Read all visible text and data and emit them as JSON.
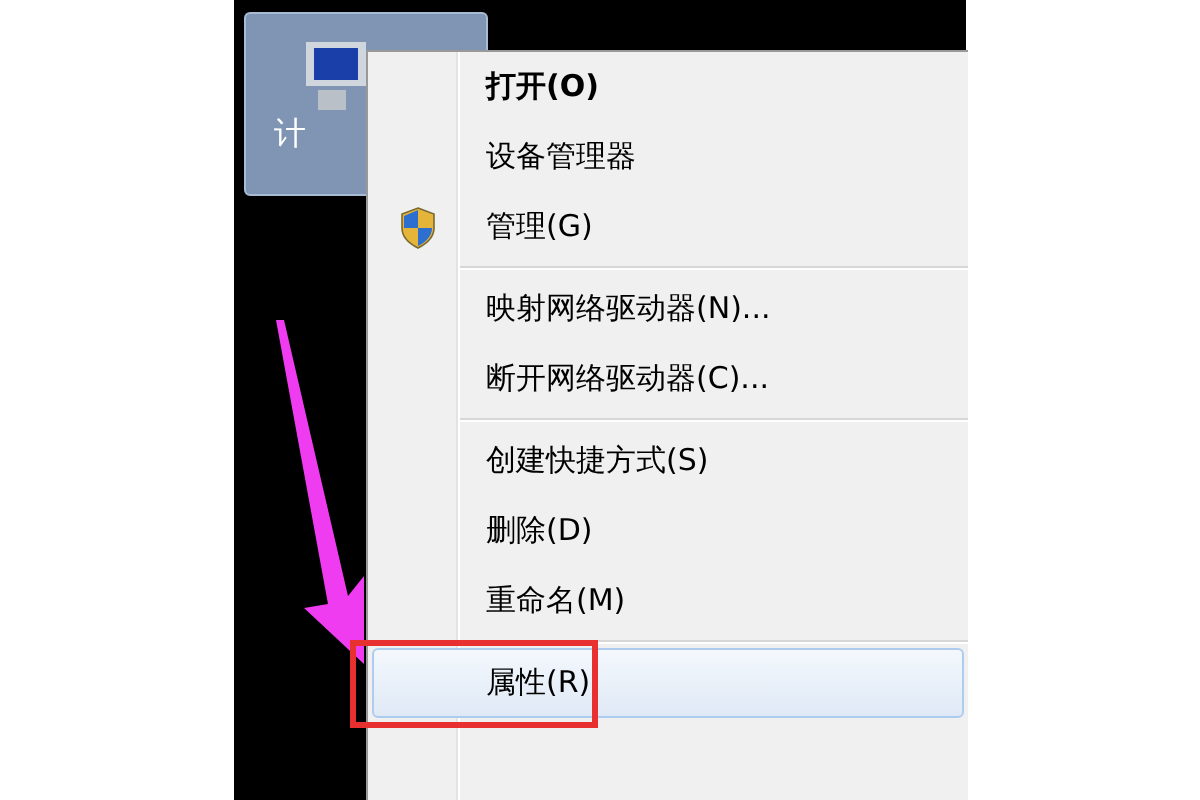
{
  "desktop_icon": {
    "label": "计"
  },
  "context_menu": {
    "items": [
      {
        "kind": "item",
        "label": "打开(O)",
        "bold": true,
        "shield": false,
        "selected": false
      },
      {
        "kind": "item",
        "label": "设备管理器",
        "bold": false,
        "shield": false,
        "selected": false
      },
      {
        "kind": "item",
        "label": "管理(G)",
        "bold": false,
        "shield": true,
        "selected": false
      },
      {
        "kind": "separator"
      },
      {
        "kind": "item",
        "label": "映射网络驱动器(N)...",
        "bold": false,
        "shield": false,
        "selected": false
      },
      {
        "kind": "item",
        "label": "断开网络驱动器(C)...",
        "bold": false,
        "shield": false,
        "selected": false
      },
      {
        "kind": "separator"
      },
      {
        "kind": "item",
        "label": "创建快捷方式(S)",
        "bold": false,
        "shield": false,
        "selected": false
      },
      {
        "kind": "item",
        "label": "删除(D)",
        "bold": false,
        "shield": false,
        "selected": false
      },
      {
        "kind": "item",
        "label": "重命名(M)",
        "bold": false,
        "shield": false,
        "selected": false
      },
      {
        "kind": "separator"
      },
      {
        "kind": "item",
        "label": "属性(R)",
        "bold": false,
        "shield": false,
        "selected": true
      }
    ]
  }
}
